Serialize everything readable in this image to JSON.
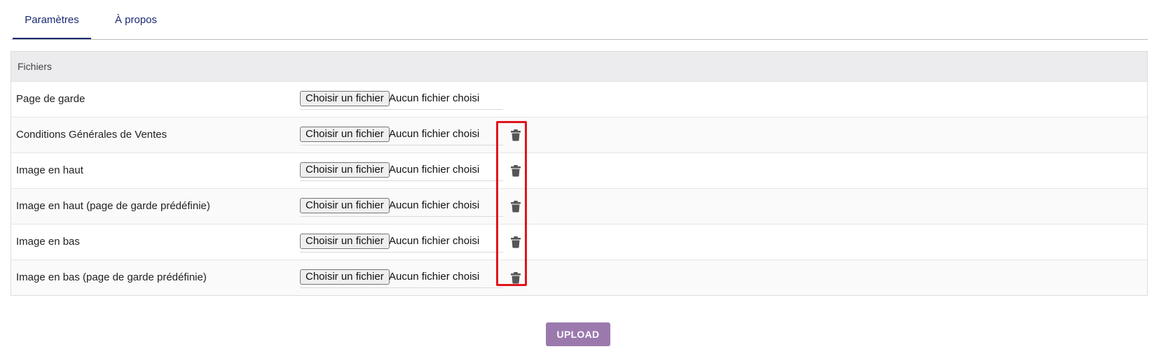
{
  "tabs": [
    {
      "label": "Paramètres",
      "active": true
    },
    {
      "label": "À propos",
      "active": false
    }
  ],
  "section": {
    "title": "Fichiers"
  },
  "file_input": {
    "button_label": "Choisir un fichier",
    "status_text": "Aucun fichier choisi"
  },
  "rows": [
    {
      "label": "Page de garde",
      "has_delete": false
    },
    {
      "label": "Conditions Générales de Ventes",
      "has_delete": true
    },
    {
      "label": "Image en haut",
      "has_delete": true
    },
    {
      "label": "Image en haut (page de garde prédéfinie)",
      "has_delete": true
    },
    {
      "label": "Image en bas",
      "has_delete": true
    },
    {
      "label": "Image en bas (page de garde prédéfinie)",
      "has_delete": true
    }
  ],
  "icons": {
    "delete": "trash-icon"
  },
  "upload": {
    "label": "UPLOAD"
  },
  "colors": {
    "tab_text": "#1b2a73",
    "upload_bg": "#9b79ad",
    "highlight": "#e0151b",
    "trash": "#555555"
  }
}
